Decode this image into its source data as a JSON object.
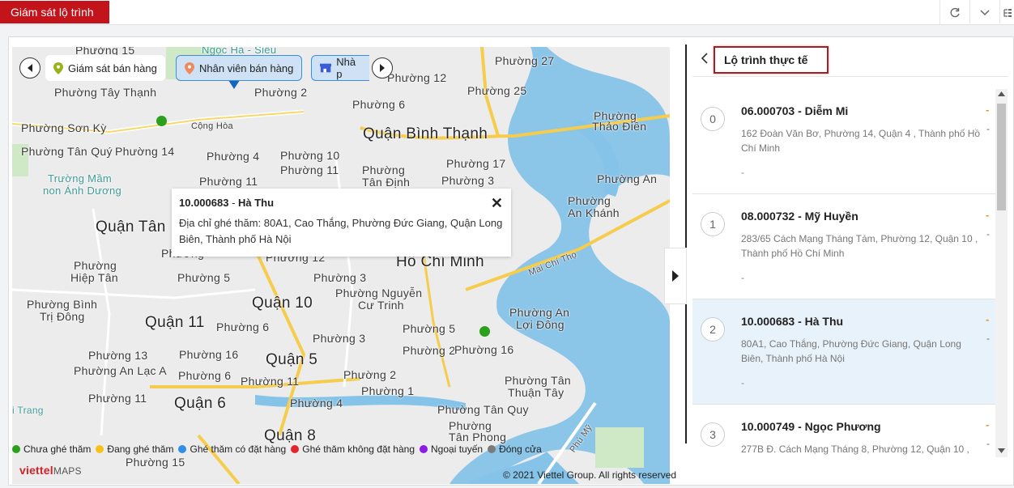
{
  "topbar": {
    "tab_label": "Giám sát lộ trình",
    "refresh_icon": "refresh-icon",
    "collapse_icon": "chevron-down-icon",
    "settings_icon": "tree-icon"
  },
  "map": {
    "chips": [
      {
        "label": "Giám sát bán hàng",
        "icon": "pin-icon"
      },
      {
        "label": "Nhân viên bán hàng",
        "icon": "location-icon"
      },
      {
        "label": "Nhà p",
        "icon": "store-icon"
      }
    ],
    "labels": {
      "quan_binh_thanh": "Quận Bình Thạnh",
      "ho_chi_minh": "Hồ Chí Minh",
      "quan_tan": "Quận Tân",
      "quan_10": "Quận 10",
      "quan_11": "Quận 11",
      "quan_5": "Quận 5",
      "quan_6": "Quận 6",
      "quan_8": "Quận 8",
      "cong_hoa": "Cộng Hòa",
      "mai_chi_tho": "Mai Chí Thọ",
      "phu_my": "Phú Mỹ",
      "truong_mam_1": "Trường Mầm",
      "truong_mam_2": "non Ánh Dương",
      "ngoc_ha": "Ngọc Hà - Siêu",
      "tay_thanh_1": "Phường 15",
      "tay_thanh": "Phường Tây Thạnh",
      "son_ky": "Phường Sơn Kỳ",
      "tan_quy": "Phường Tân Quý",
      "p14": "Phường 14",
      "p2_top": "Phường 2",
      "p6_top": "Phường 6",
      "p27": "Phường 27",
      "p12_top": "Phường 12",
      "p25": "Phường 25",
      "p4_a": "Phường 4",
      "p10_a": "Phường 10",
      "p11_a": "Phường 11",
      "p11_b": "Phường 11",
      "phuong_1": "Phường",
      "tan_dinh": "Tân Định",
      "p17": "Phường 17",
      "p3_top": "Phường 3",
      "thao_dien_1": "Phường",
      "thao_dien_2": "Thảo Điền",
      "an_1": "Phường An",
      "an_khanh_1": "Phường",
      "an_khanh_2": "An Khánh",
      "phuong_left": "Phường",
      "p12_mid": "Phường 12",
      "hiep_tan_1": "Phường",
      "hiep_tan_2": "Hiệp Tân",
      "p5_a": "Phường 5",
      "p3_mid": "Phường 3",
      "nguyen_cu_trinh_1": "Phường Nguyễn",
      "nguyen_cu_trinh_2": "Cư Trinh",
      "an_loi_dong_1": "Phường An",
      "an_loi_dong_2": "Lợi Đông",
      "binh_tri_dong_1": "Phường Bình",
      "binh_tri_dong_2": "Trị Đông",
      "p6_mid": "Phường 6",
      "p3_low": "Phường 3",
      "p5_b": "Phường 5",
      "p2_low": "Phường 2",
      "p16_a": "Phường 16",
      "p13": "Phường 13",
      "p16_b": "Phường 16",
      "an_lac_a": "Phường An Lạc A",
      "p6_low": "Phường 6",
      "p11_c": "Phường 11",
      "p2_c": "Phường 2",
      "p1": "Phường 1",
      "tan_thuan_tay_1": "Phường Tân",
      "tan_thuan_tay_2": "Thuận Tây",
      "p11_d": "Phường 11",
      "p4_low": "Phường 4",
      "tan_quy_2": "Phường Tân Quy",
      "tan_phong_1": "Phường",
      "tan_phong_2": "Tân Phong",
      "p15": "Phường 15",
      "trang": "i Trang"
    },
    "popup": {
      "code": "10.000683",
      "name": "Hà Thu",
      "address": "Địa chỉ ghé thăm: 80A1, Cao Thắng, Phường Đức Giang, Quận Long Biên, Thành phố Hà Nội"
    },
    "legend": [
      {
        "label": "Chưa ghé thăm",
        "color": "#2aa01c"
      },
      {
        "label": "Đang ghé thăm",
        "color": "#f5c218"
      },
      {
        "label": "Ghé thăm có đặt hàng",
        "color": "#2f8ee6"
      },
      {
        "label": "Ghé thăm không đặt hàng",
        "color": "#e3262d"
      },
      {
        "label": "Ngoại tuyến",
        "color": "#8d1be3"
      },
      {
        "label": "Đóng cửa",
        "color": "#7b7b7b"
      }
    ],
    "brand": "viettel",
    "brand_suffix": "MAPS",
    "copyright": "© 2021 Viettel Group. All rights reserved"
  },
  "route_panel": {
    "title": "Lộ trình thực tế",
    "items": [
      {
        "index": "0",
        "title": "06.000703 - Diễm Mi",
        "address": "162 Đoàn Văn Bơ, Phường 14, Quận 4 , Thành phố Hồ Chí Minh",
        "note": "-",
        "selected": false
      },
      {
        "index": "1",
        "title": "08.000732 - Mỹ Huyền",
        "address": "283/65 Cách Mạng Tháng Tám, Phường 12, Quận 10 , Thành phố Hồ Chí Minh",
        "note": "-",
        "selected": false
      },
      {
        "index": "2",
        "title": "10.000683 - Hà Thu",
        "address": "80A1, Cao Thắng, Phường Đức Giang, Quận Long Biên, Thành phố Hà Nội",
        "note": "-",
        "selected": true
      },
      {
        "index": "3",
        "title": "10.000749 - Ngọc Phương",
        "address": "277B Đ. Cách Mạng Tháng 8, Phường 12, Quận 10 ,",
        "note": "-",
        "selected": false
      }
    ],
    "side_marks": [
      "-",
      "-"
    ]
  }
}
